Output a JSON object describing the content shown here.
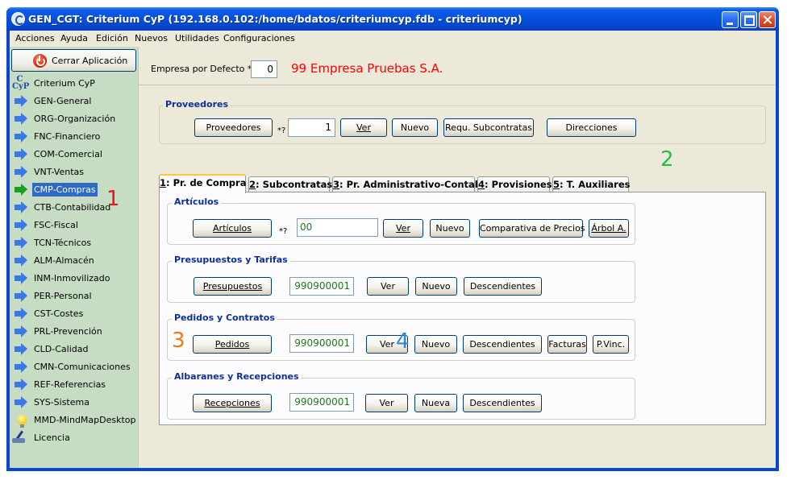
{
  "window": {
    "title": "GEN_CGT: Criterium CyP (192.168.0.102:/home/bdatos/criteriumcyp.fdb - criteriumcyp)"
  },
  "menu": [
    {
      "label": "Acciones"
    },
    {
      "label": "Ayuda"
    },
    {
      "label": "Edición"
    },
    {
      "label": "Nuevos"
    },
    {
      "label": "Utilidades"
    },
    {
      "label": "Configuraciones"
    }
  ],
  "sidebar": {
    "close_app": "Cerrar Aplicación",
    "items": [
      {
        "label": "Criterium CyP",
        "icon": "criterium-logo-icon"
      },
      {
        "label": "GEN-General",
        "icon": "arrow-right-icon"
      },
      {
        "label": "ORG-Organización",
        "icon": "arrow-right-icon"
      },
      {
        "label": "FNC-Financiero",
        "icon": "arrow-right-icon"
      },
      {
        "label": "COM-Comercial",
        "icon": "arrow-right-icon"
      },
      {
        "label": "VNT-Ventas",
        "icon": "arrow-right-icon"
      },
      {
        "label": "CMP-Compras",
        "icon": "arrow-right-green-icon",
        "selected": true
      },
      {
        "label": "CTB-Contabilidad",
        "icon": "arrow-right-icon"
      },
      {
        "label": "FSC-Fiscal",
        "icon": "arrow-right-icon"
      },
      {
        "label": "TCN-Técnicos",
        "icon": "arrow-right-icon"
      },
      {
        "label": "ALM-Almacén",
        "icon": "arrow-right-icon"
      },
      {
        "label": "INM-Inmovilizado",
        "icon": "arrow-right-icon"
      },
      {
        "label": "PER-Personal",
        "icon": "arrow-right-icon"
      },
      {
        "label": "CST-Costes",
        "icon": "arrow-right-icon"
      },
      {
        "label": "PRL-Prevención",
        "icon": "arrow-right-icon"
      },
      {
        "label": "CLD-Calidad",
        "icon": "arrow-right-icon"
      },
      {
        "label": "CMN-Comunicaciones",
        "icon": "arrow-right-icon"
      },
      {
        "label": "REF-Referencias",
        "icon": "arrow-right-icon"
      },
      {
        "label": "SYS-Sistema",
        "icon": "arrow-right-icon"
      },
      {
        "label": "MMD-MindMapDesktop",
        "icon": "lightbulb-icon"
      },
      {
        "label": "Licencia",
        "icon": "license-pen-icon"
      }
    ]
  },
  "company": {
    "label": "Empresa por Defecto *?",
    "code": "0",
    "name": "99 Empresa Pruebas S.A."
  },
  "proveedores": {
    "legend": "Proveedores",
    "button": "Proveedores",
    "star": "*?",
    "value": "1",
    "ver": "Ver",
    "nuevo": "Nuevo",
    "requ": "Requ. Subcontratas",
    "direcciones": "Direcciones"
  },
  "tabs": [
    {
      "key": "1",
      "label": ": Pr. de Compra",
      "active": true
    },
    {
      "key": "2",
      "label": ": Subcontratas"
    },
    {
      "key": "3",
      "label": ": Pr. Administrativo-Contable"
    },
    {
      "key": "4",
      "label": ": Provisiones"
    },
    {
      "key": "5",
      "label": ": T. Auxiliares"
    }
  ],
  "articulos": {
    "legend": "Artículos",
    "button": "Artículos",
    "star": "*?",
    "value": "00",
    "ver": "Ver",
    "nuevo": "Nuevo",
    "comparativa": "Comparativa de Precios",
    "arbol": "Árbol A."
  },
  "presupuestos": {
    "legend": "Presupuestos y Tarifas",
    "button": "Presupuestos",
    "value": "990900001",
    "ver": "Ver",
    "nuevo": "Nuevo",
    "descendientes": "Descendientes"
  },
  "pedidos": {
    "legend": "Pedidos y Contratos",
    "button": "Pedidos",
    "value": "990900001",
    "ver": "Ver",
    "nuevo": "Nuevo",
    "descendientes": "Descendientes",
    "facturas": "Facturas",
    "pvinc": "P.Vinc."
  },
  "albaranes": {
    "legend": "Albaranes y Recepciones",
    "button": "Recepciones",
    "value": "990900001",
    "ver": "Ver",
    "nueva": "Nueva",
    "descendientes": "Descendientes"
  },
  "annotations": [
    {
      "text": "1",
      "color": "#e8141c"
    },
    {
      "text": "2",
      "color": "#22c040"
    },
    {
      "text": "3",
      "color": "#f07818"
    },
    {
      "text": "4",
      "color": "#2a86e0"
    }
  ]
}
